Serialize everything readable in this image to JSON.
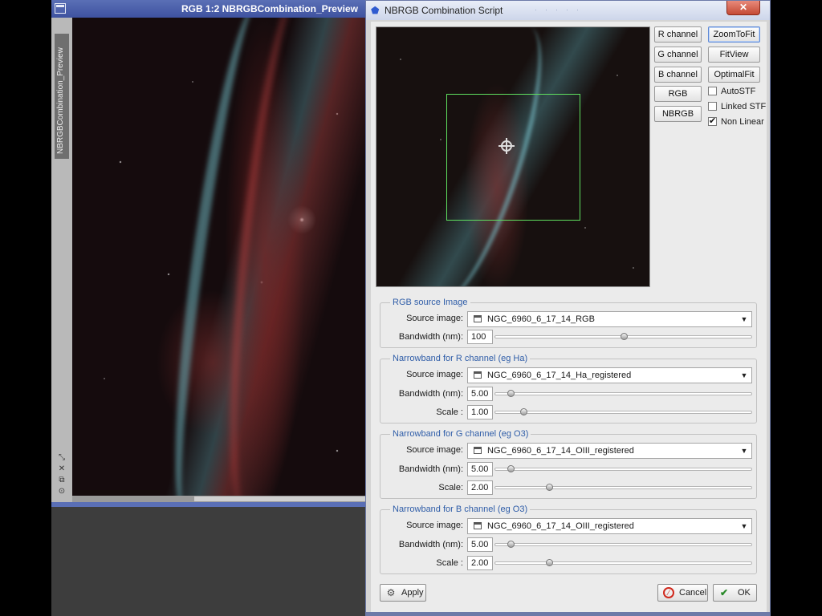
{
  "image_window": {
    "title": "RGB 1:2 NBRGBCombination_Preview",
    "side_tab": "NBRGBCombination_Preview"
  },
  "dialog": {
    "title": "NBRGB Combination Script",
    "close_label": "✕",
    "channel_buttons": [
      "R channel",
      "G channel",
      "B channel",
      "RGB",
      "NBRGB"
    ],
    "view_buttons": {
      "zoom_to_fit": "ZoomToFit",
      "fit_view": "FitView",
      "optimal_fit": "OptimalFit"
    },
    "checkboxes": [
      {
        "label": "AutoSTF",
        "checked": false
      },
      {
        "label": "Linked STF",
        "checked": false
      },
      {
        "label": "Non Linear",
        "checked": true
      }
    ],
    "rgb_group": {
      "legend": "RGB source Image",
      "source_label": "Source image:",
      "source_value": "NGC_6960_6_17_14_RGB",
      "bandwidth_label": "Bandwidth (nm):",
      "bandwidth_value": "100",
      "bandwidth_slider": 0.5
    },
    "r_group": {
      "legend": "Narrowband for R channel (eg Ha)",
      "source_label": "Source image:",
      "source_value": "NGC_6960_6_17_14_Ha_registered",
      "bandwidth_label": "Bandwidth (nm):",
      "bandwidth_value": "5.00",
      "bandwidth_slider": 0.06,
      "scale_label": "Scale :",
      "scale_value": "1.00",
      "scale_slider": 0.11
    },
    "g_group": {
      "legend": "Narrowband for G channel (eg O3)",
      "source_label": "Source image:",
      "source_value": "NGC_6960_6_17_14_OIII_registered",
      "bandwidth_label": "Bandwidth (nm):",
      "bandwidth_value": "5.00",
      "bandwidth_slider": 0.06,
      "scale_label": "Scale:",
      "scale_value": "2.00",
      "scale_slider": 0.21
    },
    "b_group": {
      "legend": "Narrowband for B channel (eg O3)",
      "source_label": "Source image:",
      "source_value": "NGC_6960_6_17_14_OIII_registered",
      "bandwidth_label": "Bandwidth (nm):",
      "bandwidth_value": "5.00",
      "bandwidth_slider": 0.06,
      "scale_label": "Scale :",
      "scale_value": "2.00",
      "scale_slider": 0.21
    },
    "apply_label": "Apply",
    "cancel_label": "Cancel",
    "ok_label": "OK"
  }
}
